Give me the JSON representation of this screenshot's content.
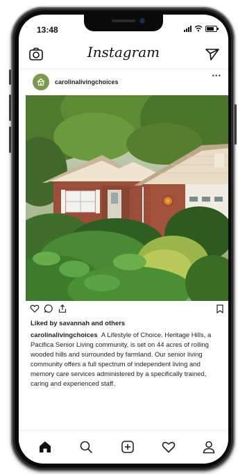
{
  "status_bar": {
    "time": "13:48"
  },
  "header": {
    "logo_text": "Instagram"
  },
  "post": {
    "username": "carolinalivingchoices",
    "more_label": "•••",
    "liked_text": "Liked by savannah and others",
    "caption_user": "carolinalivingchoices",
    "caption_text": "A Lifestyle of Choice. Heritage Hills, a Pacifica Senior Living community, is set on 44 acres of rolling wooded hills and surrounded by farmland. Our senior living community offers a full spectrum of independent living and memory care services administered by a specifically trained, caring and experienced staff."
  },
  "icons": {
    "header": [
      "camera-icon",
      "send-icon"
    ],
    "actions": [
      "heart-icon",
      "comment-icon",
      "share-icon",
      "bookmark-icon"
    ],
    "nav": [
      "home-icon",
      "search-icon",
      "add-post-icon",
      "activity-heart-icon",
      "profile-icon"
    ]
  },
  "colors": {
    "avatar": "#7b9a4d",
    "phone_frame": "#0a0a0a"
  }
}
